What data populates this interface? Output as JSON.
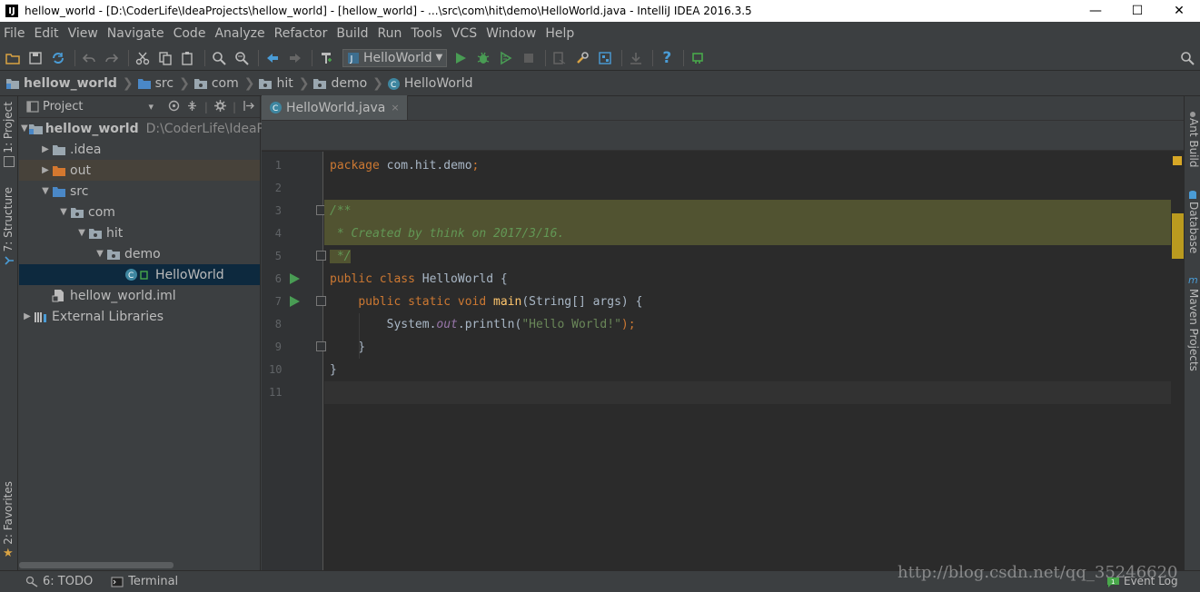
{
  "window": {
    "title": "hellow_world - [D:\\CoderLife\\IdeaProjects\\hellow_world] - [hellow_world] - ...\\src\\com\\hit\\demo\\HelloWorld.java - IntelliJ IDEA 2016.3.5",
    "logo_letter": "IJ",
    "minimize": "—",
    "maximize": "☐",
    "close": "✕"
  },
  "menu": [
    "File",
    "Edit",
    "View",
    "Navigate",
    "Code",
    "Analyze",
    "Refactor",
    "Build",
    "Run",
    "Tools",
    "VCS",
    "Window",
    "Help"
  ],
  "toolbar": {
    "run_config": "HelloWorld",
    "help": "?"
  },
  "nav": {
    "crumbs": [
      "hellow_world",
      "src",
      "com",
      "hit",
      "demo",
      "HelloWorld"
    ]
  },
  "left_tabs": {
    "project": "1: Project",
    "structure": "7: Structure",
    "favorites": "2: Favorites"
  },
  "right_tabs": {
    "ant": "Ant Build",
    "database": "Database",
    "maven": "Maven Projects"
  },
  "project_panel": {
    "title": "Project",
    "caret": "▾",
    "tree": [
      {
        "label": "hellow_world",
        "hint": "D:\\CoderLife\\IdeaP",
        "indent": 0,
        "arrow": "▼",
        "icon": "module-folder-icon"
      },
      {
        "label": ".idea",
        "indent": 1,
        "arrow": "▶",
        "icon": "folder-icon"
      },
      {
        "label": "out",
        "indent": 1,
        "arrow": "▶",
        "icon": "excluded-folder-icon"
      },
      {
        "label": "src",
        "indent": 1,
        "arrow": "▼",
        "icon": "source-folder-icon"
      },
      {
        "label": "com",
        "indent": 2,
        "arrow": "▼",
        "icon": "package-icon"
      },
      {
        "label": "hit",
        "indent": 3,
        "arrow": "▼",
        "icon": "package-icon"
      },
      {
        "label": "demo",
        "indent": 4,
        "arrow": "▼",
        "icon": "package-icon"
      },
      {
        "label": "HelloWorld",
        "indent": 5,
        "arrow": "",
        "icon": "java-class-icon"
      },
      {
        "label": "hellow_world.iml",
        "indent": 1,
        "arrow": "",
        "icon": "iml-file-icon"
      },
      {
        "label": "External Libraries",
        "indent": 0,
        "arrow": "▶",
        "icon": "libraries-icon"
      }
    ]
  },
  "editor": {
    "tab_label": "HelloWorld.java",
    "tab_close": "×",
    "line_numbers": [
      "1",
      "2",
      "3",
      "4",
      "5",
      "6",
      "7",
      "8",
      "9",
      "10",
      "11"
    ]
  },
  "status": {
    "todo": "6: TODO",
    "terminal": "Terminal",
    "event_log": "Event Log",
    "watermark": "http://blog.csdn.net/qq_35246620"
  },
  "colors": {
    "editor_bg": "#2b2b2b",
    "panel_bg": "#3c3f41",
    "keyword": "#cc7832",
    "string": "#6a8759",
    "doc_comment": "#629755",
    "method": "#ffc66d",
    "static_field": "#9876aa",
    "run_green": "#499c54"
  }
}
